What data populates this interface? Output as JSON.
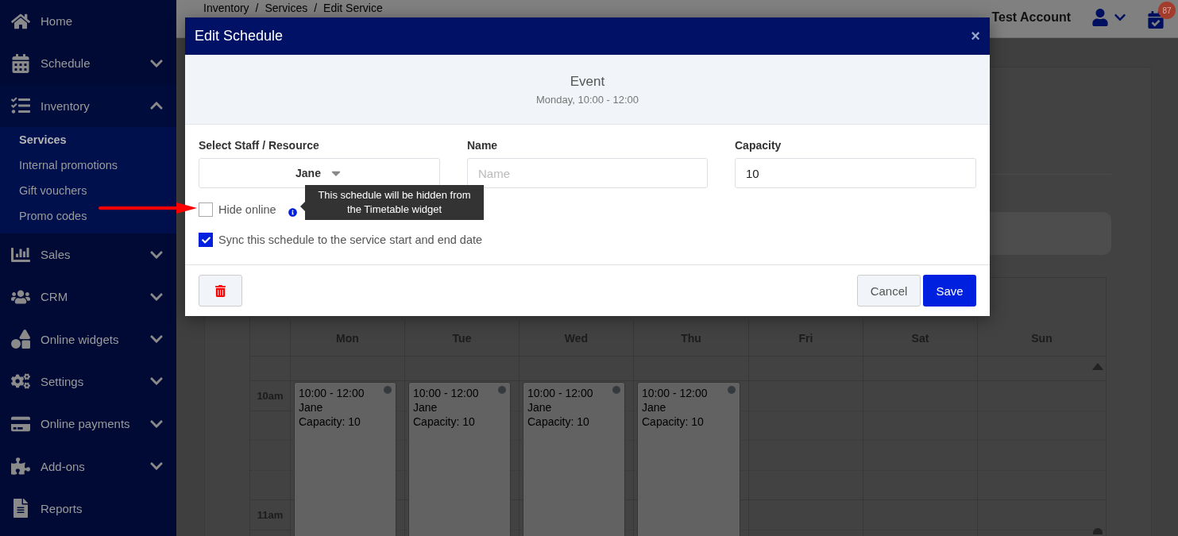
{
  "sidebar": {
    "items": [
      {
        "label": "Home",
        "kind": "link"
      },
      {
        "label": "Schedule",
        "kind": "group",
        "expanded": false
      },
      {
        "label": "Inventory",
        "kind": "group",
        "expanded": true,
        "children": [
          {
            "label": "Services",
            "selected": true
          },
          {
            "label": "Internal promotions",
            "selected": false
          },
          {
            "label": "Gift vouchers",
            "selected": false
          },
          {
            "label": "Promo codes",
            "selected": false
          }
        ]
      },
      {
        "label": "Sales",
        "kind": "group",
        "expanded": false
      },
      {
        "label": "CRM",
        "kind": "group",
        "expanded": false
      },
      {
        "label": "Online widgets",
        "kind": "group",
        "expanded": false
      },
      {
        "label": "Settings",
        "kind": "group",
        "expanded": false
      },
      {
        "label": "Online payments",
        "kind": "group",
        "expanded": false
      },
      {
        "label": "Add-ons",
        "kind": "group",
        "expanded": false
      },
      {
        "label": "Reports",
        "kind": "link"
      }
    ]
  },
  "topbar": {
    "breadcrumb": [
      {
        "label": "Inventory"
      },
      {
        "separator": "/",
        "label": "Services"
      },
      {
        "separator": "/",
        "label": "Edit Service"
      }
    ],
    "account": "Test Account",
    "notifications": "87"
  },
  "calendar": {
    "times": [
      "10am",
      "11am"
    ],
    "days": [
      {
        "label": "Mon",
        "events": [
          {
            "time": "10:00 - 12:00",
            "staff": "Jane",
            "capacity": "Capacity: 10"
          }
        ]
      },
      {
        "label": "Tue",
        "events": [
          {
            "time": "10:00 - 12:00",
            "staff": "Jane",
            "capacity": "Capacity: 10"
          }
        ]
      },
      {
        "label": "Wed",
        "events": [
          {
            "time": "10:00 - 12:00",
            "staff": "Jane",
            "capacity": "Capacity: 10"
          }
        ]
      },
      {
        "label": "Thu",
        "events": [
          {
            "time": "10:00 - 12:00",
            "staff": "Jane",
            "capacity": "Capacity: 10"
          }
        ]
      },
      {
        "label": "Fri"
      },
      {
        "label": "Sat"
      },
      {
        "label": "Sun"
      }
    ]
  },
  "modal": {
    "title": "Edit Schedule",
    "close": "×",
    "event": {
      "title": "Event",
      "subtitle": "Monday, 10:00 - 12:00"
    },
    "staff": {
      "label": "Select Staff / Resource",
      "value": "Jane"
    },
    "name": {
      "label": "Name",
      "placeholder": "Name"
    },
    "capacity": {
      "label": "Capacity",
      "value": "10"
    },
    "checkboxes": [
      {
        "label": "Hide online",
        "checked": false,
        "info": true
      },
      {
        "label": "Sync this schedule to the service start and end date",
        "checked": true,
        "info": false
      }
    ],
    "tooltip": "This schedule will be hidden from the Timetable widget",
    "buttons": {
      "cancel": "Cancel",
      "save": "Save"
    }
  }
}
